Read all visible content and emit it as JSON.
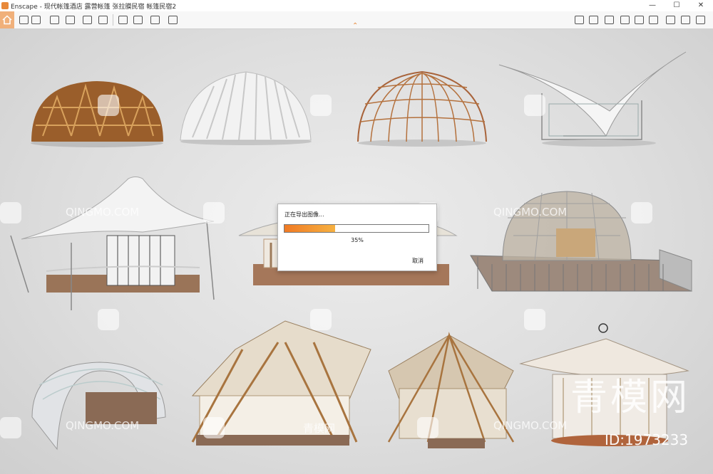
{
  "window": {
    "app_name": "Enscape",
    "title": "Enscape - 现代帐篷酒店 露营帐篷 张拉膜民宿 帐篷民宿2",
    "minimize": "—",
    "maximize": "☐",
    "close": "✕"
  },
  "toolbar": {
    "left_icons": [
      "home-icon",
      "walk-icon",
      "binoculars-icon",
      "capture-icon",
      "export-icon",
      "asset-library-icon",
      "building-icon",
      "layers-icon",
      "screenshot-icon",
      "batch-render-icon",
      "video-icon",
      "panorama-icon",
      "settings-icon"
    ],
    "right_icons": [
      "bim-icon",
      "materials-icon",
      "web-standalone-icon",
      "cube-icon",
      "vr-icon",
      "map-icon",
      "export-batch-icon",
      "feedback-icon",
      "help-icon",
      "settings-icon"
    ],
    "collapse_chevron": "⌃"
  },
  "watermarks": {
    "site_text": "QINGMO.COM",
    "small_cn": "青模网",
    "big_cn": "青模网",
    "id": "ID:1973233"
  },
  "dialog": {
    "title": "正在导出图像...",
    "progress": 0.35,
    "percent_label": "35%",
    "cancel_label": "取消"
  },
  "colors": {
    "accent": "#e8893a",
    "progress_start": "#f07a24",
    "progress_end": "#f6b141"
  }
}
